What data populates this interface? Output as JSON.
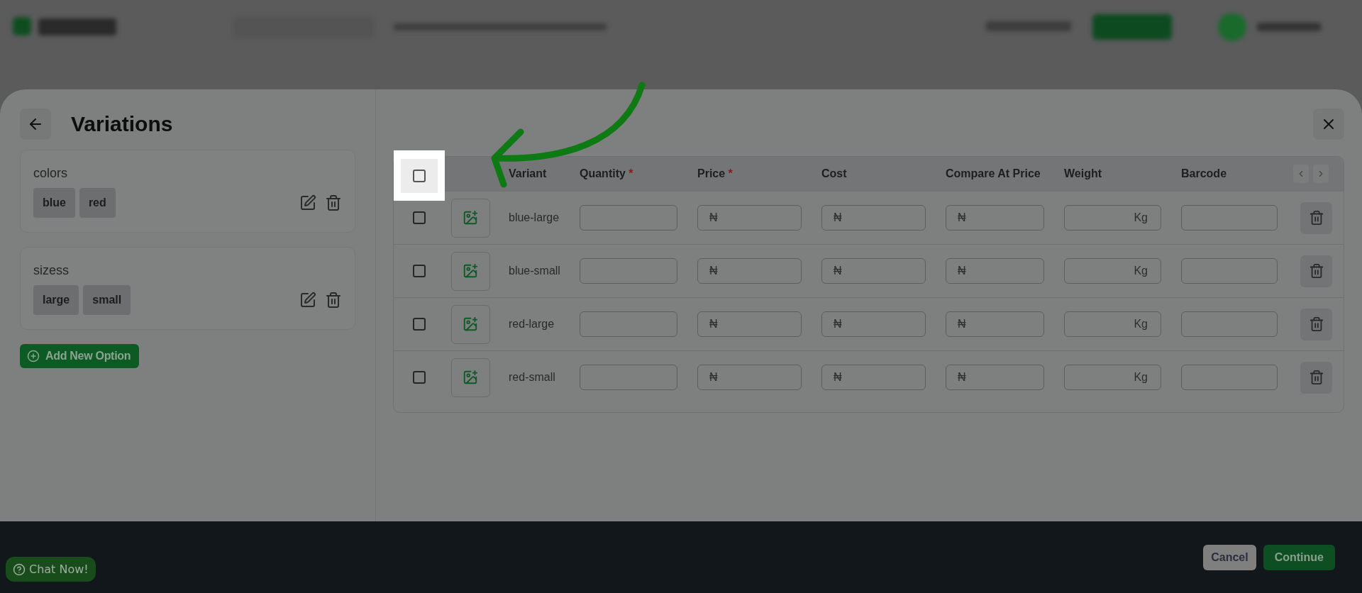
{
  "modal": {
    "title": "Variations"
  },
  "options": [
    {
      "name": "colors",
      "values": [
        "blue",
        "red"
      ]
    },
    {
      "name": "sizess",
      "values": [
        "large",
        "small"
      ]
    }
  ],
  "add_option_button": "Add New Option",
  "table": {
    "select_all": {
      "checked": false
    },
    "columns": [
      {
        "label": "Variant"
      },
      {
        "label": "Quantity",
        "required_mark": "*"
      },
      {
        "label": "Price",
        "required_mark": "*"
      },
      {
        "label": "Cost"
      },
      {
        "label": "Compare At Price"
      },
      {
        "label": "Weight"
      },
      {
        "label": "Barcode"
      }
    ],
    "rows": [
      {
        "checked": false,
        "variant": "blue-large",
        "fields": [
          {
            "kind": "plain"
          },
          {
            "kind": "currency",
            "prefix": "₦"
          },
          {
            "kind": "currency",
            "prefix": "₦"
          },
          {
            "kind": "currency",
            "prefix": "₦"
          },
          {
            "kind": "unit",
            "suffix": "Kg"
          },
          {
            "kind": "plain"
          }
        ]
      },
      {
        "checked": false,
        "variant": "blue-small",
        "fields": [
          {
            "kind": "plain"
          },
          {
            "kind": "currency",
            "prefix": "₦"
          },
          {
            "kind": "currency",
            "prefix": "₦"
          },
          {
            "kind": "currency",
            "prefix": "₦"
          },
          {
            "kind": "unit",
            "suffix": "Kg"
          },
          {
            "kind": "plain"
          }
        ]
      },
      {
        "checked": false,
        "variant": "red-large",
        "fields": [
          {
            "kind": "plain"
          },
          {
            "kind": "currency",
            "prefix": "₦"
          },
          {
            "kind": "currency",
            "prefix": "₦"
          },
          {
            "kind": "currency",
            "prefix": "₦"
          },
          {
            "kind": "unit",
            "suffix": "Kg"
          },
          {
            "kind": "plain"
          }
        ]
      },
      {
        "checked": false,
        "variant": "red-small",
        "fields": [
          {
            "kind": "plain"
          },
          {
            "kind": "currency",
            "prefix": "₦"
          },
          {
            "kind": "currency",
            "prefix": "₦"
          },
          {
            "kind": "currency",
            "prefix": "₦"
          },
          {
            "kind": "unit",
            "suffix": "Kg"
          },
          {
            "kind": "plain"
          }
        ]
      }
    ]
  },
  "footer": {
    "buttons": [
      {
        "label": "Cancel",
        "kind": "secondary"
      },
      {
        "label": "Continue",
        "kind": "primary"
      }
    ]
  },
  "chat_button": "Chat Now!"
}
